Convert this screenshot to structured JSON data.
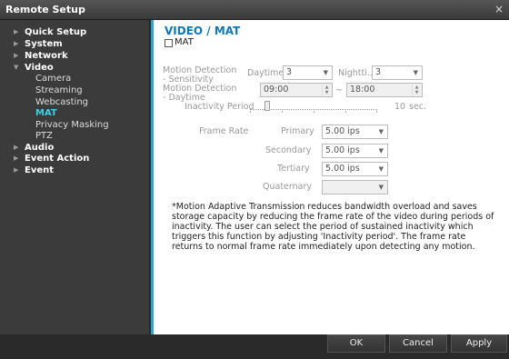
{
  "window": {
    "title": "Remote Setup",
    "close_glyph": "×"
  },
  "sidebar": {
    "items": [
      {
        "label": "Quick Setup",
        "arrow": "▶"
      },
      {
        "label": "System",
        "arrow": "▶"
      },
      {
        "label": "Network",
        "arrow": "▶"
      },
      {
        "label": "Video",
        "arrow": "▼"
      },
      {
        "label": "Camera"
      },
      {
        "label": "Streaming"
      },
      {
        "label": "Webcasting"
      },
      {
        "label": "MAT"
      },
      {
        "label": "Privacy Masking"
      },
      {
        "label": "PTZ"
      },
      {
        "label": "Audio",
        "arrow": "▶"
      },
      {
        "label": "Event Action",
        "arrow": "▶"
      },
      {
        "label": "Event",
        "arrow": "▶"
      }
    ]
  },
  "main": {
    "heading": "VIDEO / MAT",
    "mat_label": "MAT",
    "mat_checked": false,
    "sensitivity": {
      "label": "Motion Detection - Sensitivity",
      "daytime_label": "Daytime",
      "daytime_value": "3",
      "nighttime_label": "Nightti...",
      "nighttime_value": "3"
    },
    "daytime": {
      "label": "Motion Detection - Daytime",
      "start": "09:00",
      "separator": "~",
      "end": "18:00"
    },
    "inactivity": {
      "label": "Inactivity Period",
      "value": "10",
      "unit": "sec."
    },
    "frame_rate": {
      "label": "Frame Rate",
      "rows": [
        {
          "label": "Primary",
          "value": "5.00 ips"
        },
        {
          "label": "Secondary",
          "value": "5.00 ips"
        },
        {
          "label": "Tertiary",
          "value": "5.00 ips"
        },
        {
          "label": "Quaternary",
          "value": ""
        }
      ]
    },
    "note": "*Motion Adaptive Transmission reduces bandwidth overload and saves storage capacity by reducing the frame rate of the video during periods of inactivity. The user can select the period of sustained inactivity which triggers this function by adjusting 'Inactivity period'. The frame rate returns to normal frame rate immediately upon detecting any motion."
  },
  "footer": {
    "ok": "OK",
    "cancel": "Cancel",
    "apply": "Apply"
  },
  "colors": {
    "accent": "#0c78b8",
    "active_nav": "#3fd0e6",
    "divider": "#2aa8d4"
  }
}
